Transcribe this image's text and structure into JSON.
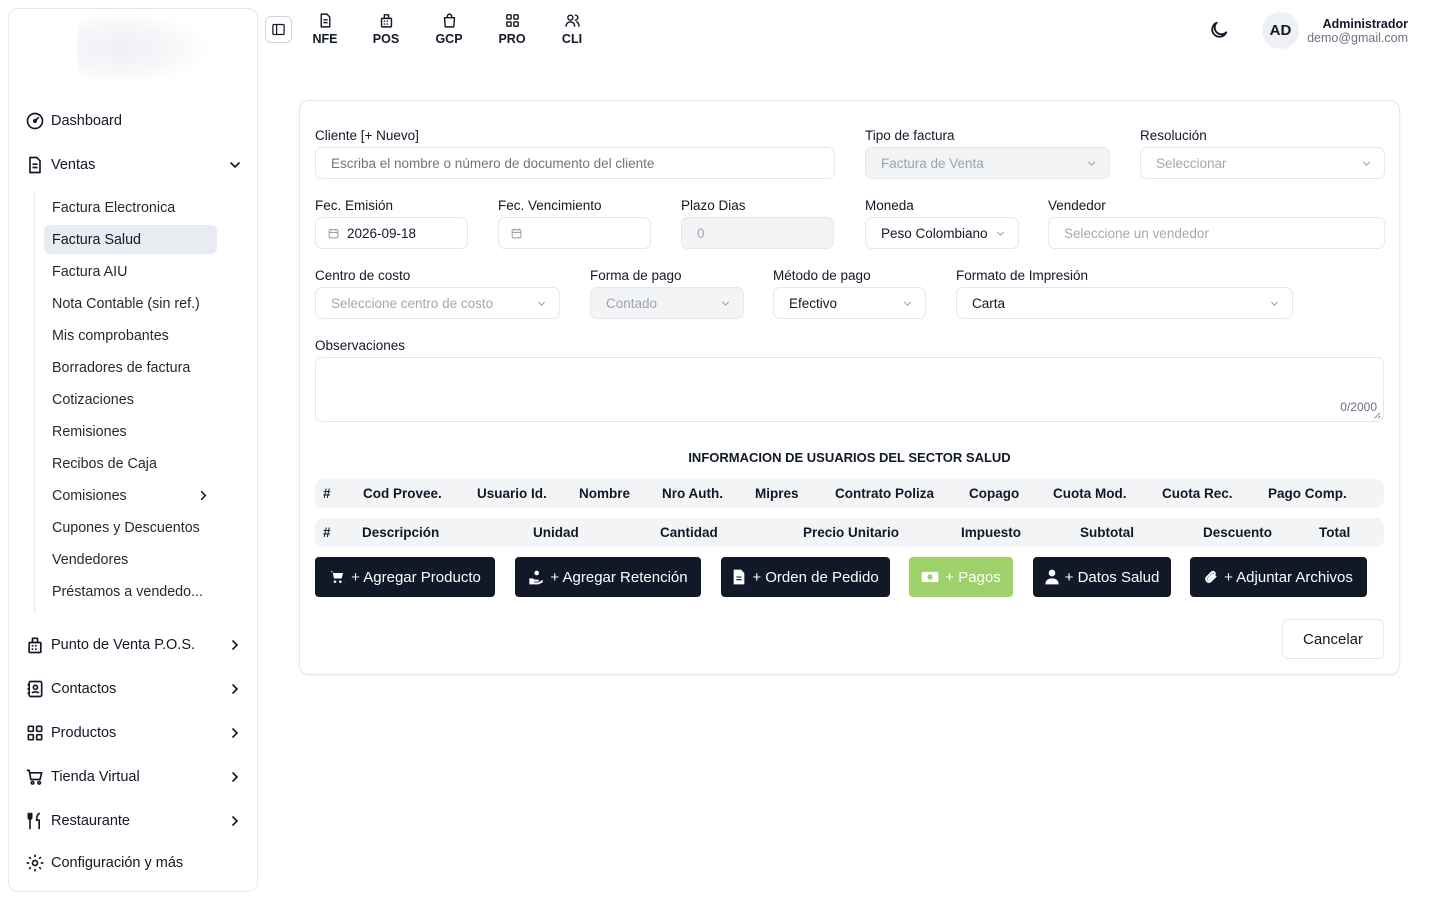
{
  "sidebar": {
    "items": [
      {
        "label": "Dashboard"
      },
      {
        "label": "Ventas"
      },
      {
        "label": "Punto de Venta P.O.S."
      },
      {
        "label": "Contactos"
      },
      {
        "label": "Productos"
      },
      {
        "label": "Tienda Virtual"
      },
      {
        "label": "Restaurante"
      },
      {
        "label": "Configuración y más"
      }
    ],
    "ventas_sub": [
      {
        "label": "Factura Electronica"
      },
      {
        "label": "Factura Salud",
        "active": true
      },
      {
        "label": "Factura AIU"
      },
      {
        "label": "Nota Contable (sin ref.)"
      },
      {
        "label": "Mis comprobantes"
      },
      {
        "label": "Borradores de factura"
      },
      {
        "label": "Cotizaciones"
      },
      {
        "label": "Remisiones"
      },
      {
        "label": "Recibos de Caja"
      },
      {
        "label": "Comisiones"
      },
      {
        "label": "Cupones y Descuentos"
      },
      {
        "label": "Vendedores"
      },
      {
        "label": "Préstamos a vendedo..."
      }
    ]
  },
  "topbar": {
    "links": [
      {
        "label": "NFE",
        "icon": "document-icon"
      },
      {
        "label": "POS",
        "icon": "register-icon"
      },
      {
        "label": "GCP",
        "icon": "shopping-bag-icon"
      },
      {
        "label": "PRO",
        "icon": "grid-icon"
      },
      {
        "label": "CLI",
        "icon": "users-icon"
      }
    ],
    "user": {
      "initials": "AD",
      "name": "Administrador",
      "email": "demo@gmail.com"
    }
  },
  "form": {
    "cliente": {
      "label": "Cliente [+ Nuevo]",
      "placeholder": "Escriba el nombre o número de documento del cliente"
    },
    "tipo_factura": {
      "label": "Tipo de factura",
      "value": "Factura de Venta"
    },
    "resolucion": {
      "label": "Resolución",
      "placeholder": "Seleccionar"
    },
    "fec_emision": {
      "label": "Fec. Emisión",
      "value": "2026-09-18"
    },
    "fec_vencimiento": {
      "label": "Fec. Vencimiento",
      "value": ""
    },
    "plazo_dias": {
      "label": "Plazo Dias",
      "value": "0"
    },
    "moneda": {
      "label": "Moneda",
      "value": "Peso Colombiano"
    },
    "vendedor": {
      "label": "Vendedor",
      "placeholder": "Seleccione un vendedor"
    },
    "centro_costo": {
      "label": "Centro de costo",
      "placeholder": "Seleccione centro de costo"
    },
    "forma_pago": {
      "label": "Forma de pago",
      "value": "Contado"
    },
    "metodo_pago": {
      "label": "Método de pago",
      "value": "Efectivo"
    },
    "formato_impresion": {
      "label": "Formato de Impresión",
      "value": "Carta"
    },
    "observaciones": {
      "label": "Observaciones",
      "counter": "0/2000"
    }
  },
  "salud_section": {
    "title": "INFORMACION DE USUARIOS DEL SECTOR SALUD",
    "columns": [
      "#",
      "Cod Provee.",
      "Usuario Id.",
      "Nombre",
      "Nro Auth.",
      "Mipres",
      "Contrato Poliza",
      "Copago",
      "Cuota Mod.",
      "Cuota Rec.",
      "Pago Comp."
    ]
  },
  "items_table": {
    "columns": [
      "#",
      "Descripción",
      "Unidad",
      "Cantidad",
      "Precio Unitario",
      "Impuesto",
      "Subtotal",
      "Descuento",
      "Total"
    ]
  },
  "actions": {
    "agregar_producto": "+ Agregar Producto",
    "agregar_retencion": "+ Agregar Retención",
    "orden_pedido": "+ Orden de Pedido",
    "pagos": "+ Pagos",
    "datos_salud": "+ Datos Salud",
    "adjuntar_archivos": "+ Adjuntar Archivos",
    "cancelar": "Cancelar"
  },
  "colors": {
    "primary": "#111827",
    "pagos_green": "#9fd16a",
    "active_bg": "#e8ebf1"
  }
}
